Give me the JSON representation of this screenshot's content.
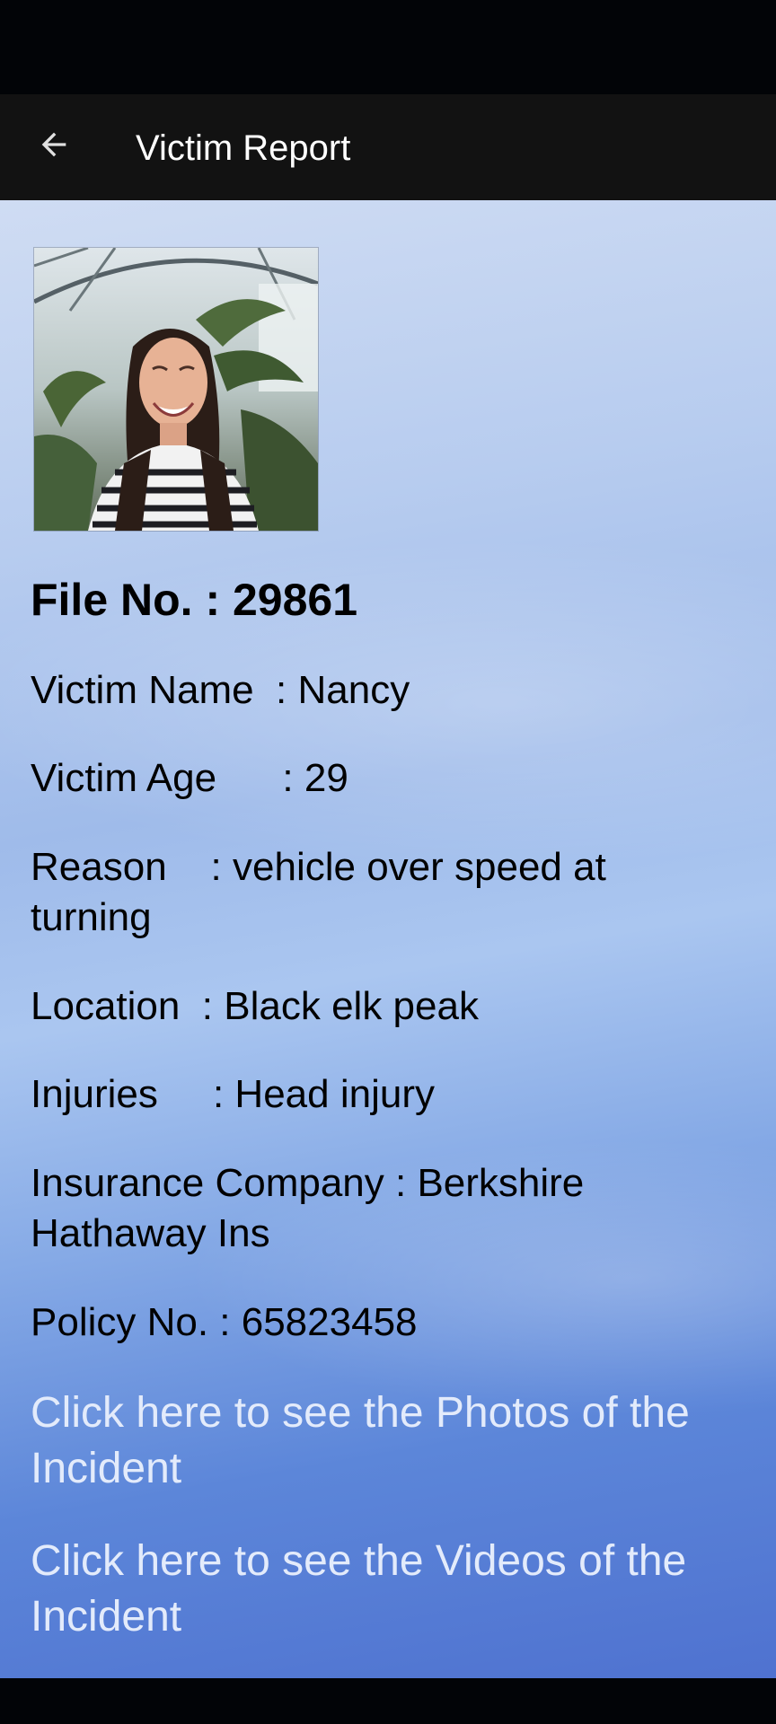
{
  "app_bar": {
    "title": "Victim Report",
    "back_icon": "arrow-left-icon"
  },
  "report": {
    "photo_alt": "victim-photo",
    "file_no": "File No. : 29861",
    "victim_name": "Victim Name  : Nancy",
    "victim_age": "Victim Age      : 29",
    "reason": "Reason    : vehicle over speed at turning",
    "location": "Location  : Black elk peak",
    "injuries": "Injuries     : Head injury",
    "insurance_company": "Insurance Company : Berkshire Hathaway Ins",
    "policy_no": "Policy No. : 65823458"
  },
  "links": {
    "photos": "Click here to see the Photos of the Incident",
    "videos": "Click here to see the Videos of the Incident"
  },
  "colors": {
    "app_bar": "#121212",
    "link_text": "#e3ebfb"
  }
}
